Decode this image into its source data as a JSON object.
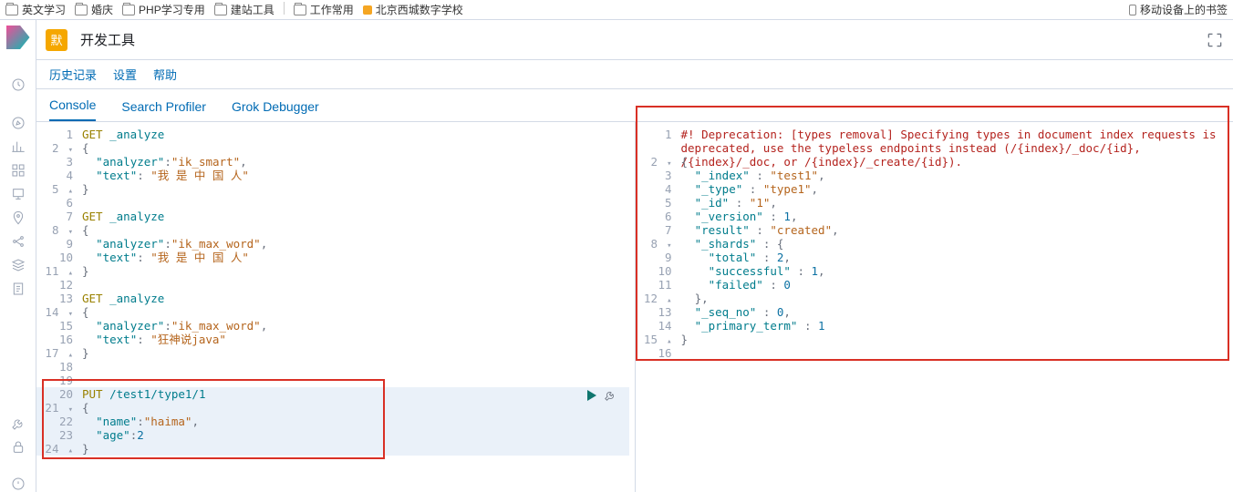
{
  "bookmarkBar": {
    "items": [
      "英文学习",
      "婚庆",
      "PHP学习专用",
      "建站工具",
      "工作常用"
    ],
    "specialItem": "北京西城数字学校",
    "rightItem": "移动设备上的书签"
  },
  "header": {
    "badge": "默",
    "title": "开发工具"
  },
  "subheader": {
    "history": "历史记录",
    "settings": "设置",
    "help": "帮助"
  },
  "tabs": {
    "console": "Console",
    "searchProfiler": "Search Profiler",
    "grokDebugger": "Grok Debugger"
  },
  "leftPane": {
    "lines": [
      {
        "n": "1",
        "t": [
          "http",
          "GET",
          " ",
          "path",
          "_analyze"
        ]
      },
      {
        "n": "2",
        "fold": "▾",
        "t": [
          "punc",
          "{"
        ]
      },
      {
        "n": "3",
        "t": [
          "  ",
          "key",
          "\"analyzer\"",
          "punc",
          ":",
          "str",
          "\"ik_smart\"",
          "punc",
          ","
        ]
      },
      {
        "n": "4",
        "t": [
          "  ",
          "key",
          "\"text\"",
          "punc",
          ":",
          " ",
          "str",
          "\"我 是 中 国 人\""
        ]
      },
      {
        "n": "5",
        "fold": "▴",
        "t": [
          "punc",
          "}"
        ]
      },
      {
        "n": "6",
        "t": [
          ""
        ]
      },
      {
        "n": "7",
        "t": [
          "http",
          "GET",
          " ",
          "path",
          "_analyze"
        ]
      },
      {
        "n": "8",
        "fold": "▾",
        "t": [
          "punc",
          "{"
        ]
      },
      {
        "n": "9",
        "t": [
          "  ",
          "key",
          "\"analyzer\"",
          "punc",
          ":",
          "str",
          "\"ik_max_word\"",
          "punc",
          ","
        ]
      },
      {
        "n": "10",
        "t": [
          "  ",
          "key",
          "\"text\"",
          "punc",
          ":",
          " ",
          "str",
          "\"我 是 中 国 人\""
        ]
      },
      {
        "n": "11",
        "fold": "▴",
        "t": [
          "punc",
          "}"
        ]
      },
      {
        "n": "12",
        "t": [
          ""
        ]
      },
      {
        "n": "13",
        "t": [
          "http",
          "GET",
          " ",
          "path",
          "_analyze"
        ]
      },
      {
        "n": "14",
        "fold": "▾",
        "t": [
          "punc",
          "{"
        ]
      },
      {
        "n": "15",
        "t": [
          "  ",
          "key",
          "\"analyzer\"",
          "punc",
          ":",
          "str",
          "\"ik_max_word\"",
          "punc",
          ","
        ]
      },
      {
        "n": "16",
        "t": [
          "  ",
          "key",
          "\"text\"",
          "punc",
          ":",
          " ",
          "str",
          "\"狂神说java\""
        ]
      },
      {
        "n": "17",
        "fold": "▴",
        "t": [
          "punc",
          "}"
        ]
      },
      {
        "n": "18",
        "t": [
          ""
        ]
      },
      {
        "n": "19",
        "t": [
          ""
        ]
      },
      {
        "n": "20",
        "t": [
          "http",
          "PUT",
          " ",
          "path",
          "/test1/type1/1"
        ]
      },
      {
        "n": "21",
        "fold": "▾",
        "t": [
          "punc",
          "{"
        ]
      },
      {
        "n": "22",
        "t": [
          "  ",
          "key",
          "\"name\"",
          "punc",
          ":",
          "str",
          "\"haima\"",
          "punc",
          ","
        ]
      },
      {
        "n": "23",
        "t": [
          "  ",
          "key",
          "\"age\"",
          "punc",
          ":",
          "num",
          "2"
        ]
      },
      {
        "n": "24",
        "fold": "▴",
        "t": [
          "punc",
          "}"
        ]
      }
    ]
  },
  "rightPane": {
    "deprecation": "#! Deprecation: [types removal] Specifying types in document index requests is deprecated, use the typeless endpoints instead (/{index}/_doc/{id}, /{index}/_doc, or /{index}/_create/{id}).",
    "lines": [
      {
        "n": "1"
      },
      {
        "n": ""
      },
      {
        "n": "2",
        "fold": "▾",
        "t": [
          "punc",
          "{"
        ]
      },
      {
        "n": "3",
        "t": [
          "  ",
          "key",
          "\"_index\"",
          " ",
          "punc",
          ":",
          " ",
          "str",
          "\"test1\"",
          "punc",
          ","
        ]
      },
      {
        "n": "4",
        "t": [
          "  ",
          "key",
          "\"_type\"",
          " ",
          "punc",
          ":",
          " ",
          "str",
          "\"type1\"",
          "punc",
          ","
        ]
      },
      {
        "n": "5",
        "t": [
          "  ",
          "key",
          "\"_id\"",
          " ",
          "punc",
          ":",
          " ",
          "str",
          "\"1\"",
          "punc",
          ","
        ]
      },
      {
        "n": "6",
        "t": [
          "  ",
          "key",
          "\"_version\"",
          " ",
          "punc",
          ":",
          " ",
          "num",
          "1",
          "punc",
          ","
        ]
      },
      {
        "n": "7",
        "t": [
          "  ",
          "key",
          "\"result\"",
          " ",
          "punc",
          ":",
          " ",
          "str",
          "\"created\"",
          "punc",
          ","
        ]
      },
      {
        "n": "8",
        "fold": "▾",
        "t": [
          "  ",
          "key",
          "\"_shards\"",
          " ",
          "punc",
          ":",
          " ",
          "punc",
          "{"
        ]
      },
      {
        "n": "9",
        "t": [
          "    ",
          "key",
          "\"total\"",
          " ",
          "punc",
          ":",
          " ",
          "num",
          "2",
          "punc",
          ","
        ]
      },
      {
        "n": "10",
        "t": [
          "    ",
          "key",
          "\"successful\"",
          " ",
          "punc",
          ":",
          " ",
          "num",
          "1",
          "punc",
          ","
        ]
      },
      {
        "n": "11",
        "t": [
          "    ",
          "key",
          "\"failed\"",
          " ",
          "punc",
          ":",
          " ",
          "num",
          "0"
        ]
      },
      {
        "n": "12",
        "fold": "▴",
        "t": [
          "  ",
          "punc",
          "}",
          "punc",
          ","
        ]
      },
      {
        "n": "13",
        "t": [
          "  ",
          "key",
          "\"_seq_no\"",
          " ",
          "punc",
          ":",
          " ",
          "num",
          "0",
          "punc",
          ","
        ]
      },
      {
        "n": "14",
        "t": [
          "  ",
          "key",
          "\"_primary_term\"",
          " ",
          "punc",
          ":",
          " ",
          "num",
          "1"
        ]
      },
      {
        "n": "15",
        "fold": "▴",
        "t": [
          "punc",
          "}"
        ]
      },
      {
        "n": "16",
        "t": [
          ""
        ]
      }
    ]
  }
}
